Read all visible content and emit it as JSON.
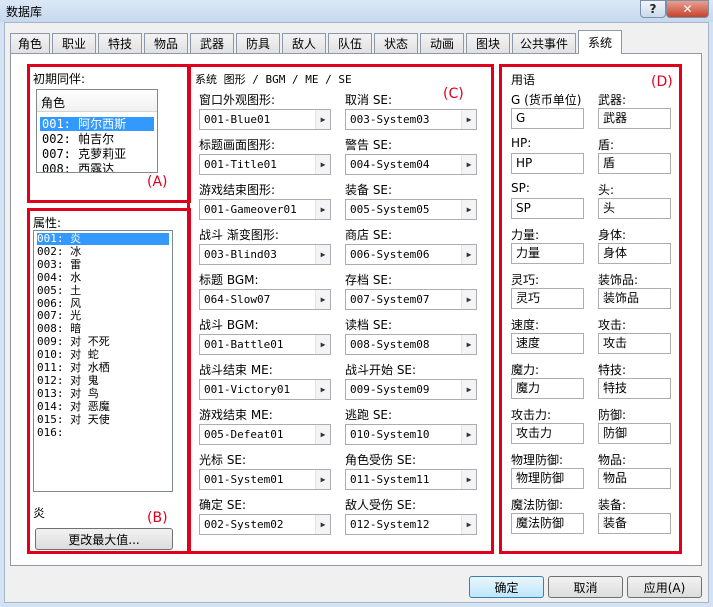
{
  "window": {
    "title": "数据库",
    "help_label": "?",
    "close_label": "✕"
  },
  "tabs": [
    "角色",
    "职业",
    "特技",
    "物品",
    "武器",
    "防具",
    "敌人",
    "队伍",
    "状态",
    "动画",
    "图块",
    "公共事件",
    "系统"
  ],
  "active_tab": "系统",
  "party": {
    "title": "初期同伴:",
    "header": "角色",
    "items": [
      "001: 阿尔西斯",
      "002: 帕吉尔",
      "007: 克萝莉亚",
      "008: 西露达"
    ],
    "selected_index": 0
  },
  "attributes": {
    "title": "属性:",
    "items": [
      "001: 炎",
      "002: 冰",
      "003: 雷",
      "004: 水",
      "005: 土",
      "006: 风",
      "007: 光",
      "008: 暗",
      "009: 对 不死",
      "010: 对 蛇",
      "011: 对 水栖",
      "012: 对 鬼",
      "013: 对 鸟",
      "014: 对 恶魔",
      "015: 对 天使",
      "016:"
    ],
    "selected_index": 0,
    "current_name": "炎",
    "change_max_label": "更改最大值..."
  },
  "system": {
    "title": "系统 图形 / BGM / ME / SE",
    "left": [
      {
        "label": "窗口外观图形:",
        "value": "001-Blue01"
      },
      {
        "label": "标题画面图形:",
        "value": "001-Title01"
      },
      {
        "label": "游戏结束图形:",
        "value": "001-Gameover01"
      },
      {
        "label": "战斗 渐变图形:",
        "value": "003-Blind03"
      },
      {
        "label": "标题 BGM:",
        "value": "064-Slow07"
      },
      {
        "label": "战斗 BGM:",
        "value": "001-Battle01"
      },
      {
        "label": "战斗结束 ME:",
        "value": "001-Victory01"
      },
      {
        "label": "游戏结束 ME:",
        "value": "005-Defeat01"
      },
      {
        "label": "光标 SE:",
        "value": "001-System01"
      },
      {
        "label": "确定 SE:",
        "value": "002-System02"
      }
    ],
    "right": [
      {
        "label": "取消 SE:",
        "value": "003-System03"
      },
      {
        "label": "警告 SE:",
        "value": "004-System04"
      },
      {
        "label": "装备 SE:",
        "value": "005-System05"
      },
      {
        "label": "商店 SE:",
        "value": "006-System06"
      },
      {
        "label": "存档 SE:",
        "value": "007-System07"
      },
      {
        "label": "读档 SE:",
        "value": "008-System08"
      },
      {
        "label": "战斗开始 SE:",
        "value": "009-System09"
      },
      {
        "label": "逃跑 SE:",
        "value": "010-System10"
      },
      {
        "label": "角色受伤 SE:",
        "value": "011-System11"
      },
      {
        "label": "敌人受伤 SE:",
        "value": "012-System12"
      }
    ]
  },
  "terms": {
    "title": "用语",
    "left": [
      {
        "label": "G (货币单位)",
        "value": "G"
      },
      {
        "label": "HP:",
        "value": "HP"
      },
      {
        "label": "SP:",
        "value": "SP"
      },
      {
        "label": "力量:",
        "value": "力量"
      },
      {
        "label": "灵巧:",
        "value": "灵巧"
      },
      {
        "label": "速度:",
        "value": "速度"
      },
      {
        "label": "魔力:",
        "value": "魔力"
      },
      {
        "label": "攻击力:",
        "value": "攻击力"
      },
      {
        "label": "物理防御:",
        "value": "物理防御"
      },
      {
        "label": "魔法防御:",
        "value": "魔法防御"
      }
    ],
    "right": [
      {
        "label": "武器:",
        "value": "武器"
      },
      {
        "label": "盾:",
        "value": "盾"
      },
      {
        "label": "头:",
        "value": "头"
      },
      {
        "label": "身体:",
        "value": "身体"
      },
      {
        "label": "装饰品:",
        "value": "装饰品"
      },
      {
        "label": "攻击:",
        "value": "攻击"
      },
      {
        "label": "特技:",
        "value": "特技"
      },
      {
        "label": "防御:",
        "value": "防御"
      },
      {
        "label": "物品:",
        "value": "物品"
      },
      {
        "label": "装备:",
        "value": "装备"
      }
    ]
  },
  "annotations": {
    "a": "(A)",
    "b": "(B)",
    "c": "(C)",
    "d": "(D)"
  },
  "buttons": {
    "ok": "确定",
    "cancel": "取消",
    "apply": "应用(A)"
  },
  "colors": {
    "annotation": "#e0001b",
    "selection": "#3399ff"
  }
}
